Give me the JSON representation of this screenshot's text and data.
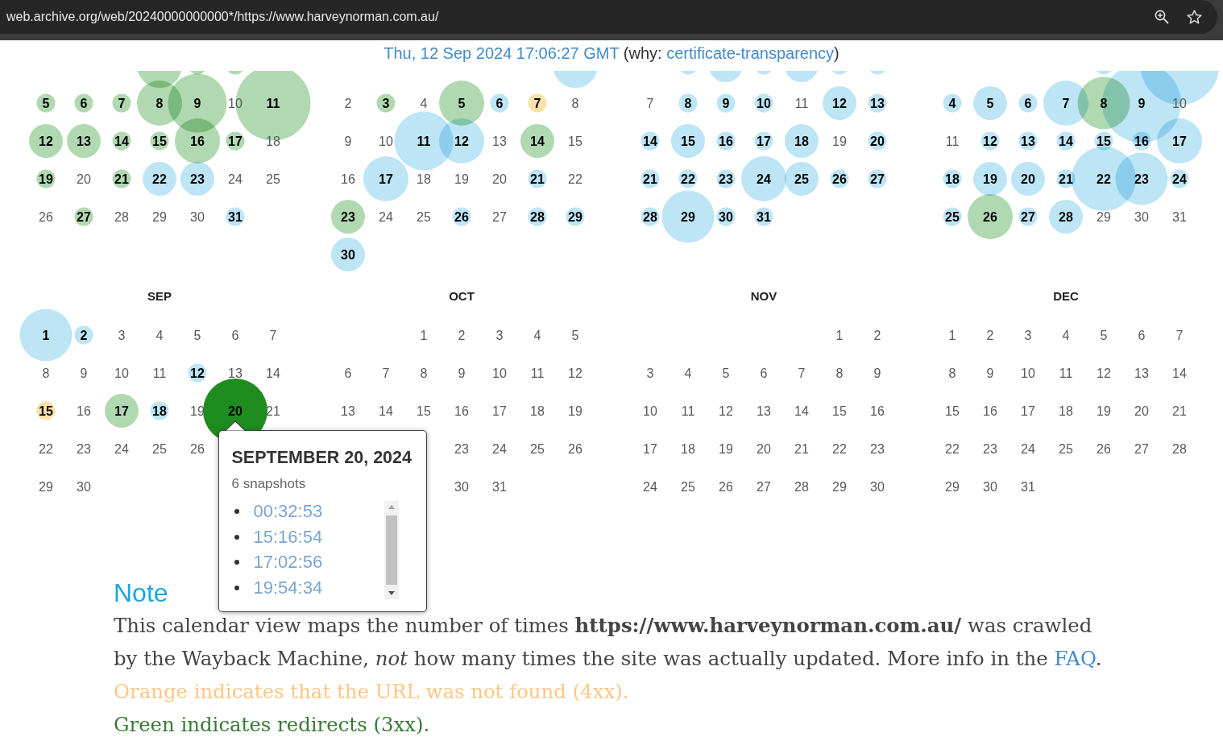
{
  "browser": {
    "url": "web.archive.org/web/20240000000000*/https://www.harveynorman.com.au/"
  },
  "capture": {
    "timestamp": "Thu, 12 Sep 2024 17:06:27 GMT",
    "reason_prefix": "(why:",
    "reason": "certificate-transparency",
    "reason_suffix": ")"
  },
  "calendar": {
    "months": [
      {
        "cut_off_week": [
          {
            "kind": "blank"
          },
          {
            "kind": "blank"
          },
          {
            "kind": "blank"
          },
          {
            "kind": "medium",
            "color": "#b1d9b1"
          },
          {
            "kind": "tiny",
            "color": "#b1d9b1"
          },
          {
            "kind": "tiny",
            "color": "#b1d9b1"
          }
        ],
        "weeks": [
          [
            {
              "kind": "tiny",
              "day": "5",
              "color": "#b1d9b1"
            },
            {
              "kind": "tiny",
              "day": "6",
              "color": "#b1d9b1"
            },
            {
              "kind": "tiny",
              "day": "7",
              "color": "#b1d9b1"
            },
            {
              "kind": "medium",
              "day": "8",
              "color": "#b1d9b1"
            },
            {
              "kind": "xlarge",
              "day": "9",
              "color": "#b1d9b1"
            },
            {
              "kind": "plain",
              "day": "10"
            },
            {
              "kind": "huge",
              "day": "11",
              "color": "#b1d9b1"
            }
          ],
          [
            {
              "kind": "small",
              "day": "12",
              "color": "#b1d9b1"
            },
            {
              "kind": "small",
              "day": "13",
              "color": "#b1d9b1"
            },
            {
              "kind": "tiny",
              "day": "14",
              "color": "#b1d9b1"
            },
            {
              "kind": "tiny",
              "day": "15",
              "color": "#b1d9b1"
            },
            {
              "kind": "medium",
              "day": "16",
              "color": "#b1d9b1"
            },
            {
              "kind": "tiny",
              "day": "17",
              "color": "#b1d9b1"
            },
            {
              "kind": "plain",
              "day": "18"
            }
          ],
          [
            {
              "kind": "tiny",
              "day": "19",
              "color": "#b1d9b1"
            },
            {
              "kind": "plain",
              "day": "20"
            },
            {
              "kind": "tiny",
              "day": "21",
              "color": "#b1d9b1"
            },
            {
              "kind": "small",
              "day": "22",
              "color": "#bde5f6"
            },
            {
              "kind": "small",
              "day": "23",
              "color": "#bde5f6"
            },
            {
              "kind": "plain",
              "day": "24"
            },
            {
              "kind": "plain",
              "day": "25"
            }
          ],
          [
            {
              "kind": "plain",
              "day": "26"
            },
            {
              "kind": "tiny",
              "day": "27",
              "color": "#b1d9b1"
            },
            {
              "kind": "plain",
              "day": "28"
            },
            {
              "kind": "plain",
              "day": "29"
            },
            {
              "kind": "plain",
              "day": "30"
            },
            {
              "kind": "tiny",
              "day": "31",
              "color": "#bde5f6"
            }
          ]
        ]
      },
      {
        "cut_off_week": [
          {
            "kind": "blank"
          },
          {
            "kind": "blank"
          },
          {
            "kind": "blank"
          },
          {
            "kind": "blank"
          },
          {
            "kind": "blank"
          },
          {
            "kind": "blank"
          },
          {
            "kind": "medium",
            "color": "#bde5f6"
          }
        ],
        "weeks": [
          [
            {
              "kind": "plain",
              "day": "2"
            },
            {
              "kind": "tiny",
              "day": "3",
              "color": "#b1d9b1"
            },
            {
              "kind": "plain",
              "day": "4"
            },
            {
              "kind": "medium",
              "day": "5",
              "color": "#b1d9b1"
            },
            {
              "kind": "tiny",
              "day": "6",
              "color": "#bde5f6"
            },
            {
              "kind": "tiny",
              "day": "7",
              "color": "#ffe0a8"
            },
            {
              "kind": "plain",
              "day": "8"
            }
          ],
          [
            {
              "kind": "plain",
              "day": "9"
            },
            {
              "kind": "plain",
              "day": "10"
            },
            {
              "kind": "xlarge",
              "day": "11",
              "color": "#bde5f6"
            },
            {
              "kind": "medium",
              "day": "12",
              "color": "#bde5f6"
            },
            {
              "kind": "plain",
              "day": "13"
            },
            {
              "kind": "small",
              "day": "14",
              "color": "#b1d9b1"
            },
            {
              "kind": "plain",
              "day": "15"
            }
          ],
          [
            {
              "kind": "plain",
              "day": "16"
            },
            {
              "kind": "medium",
              "day": "17",
              "color": "#bde5f6"
            },
            {
              "kind": "plain",
              "day": "18"
            },
            {
              "kind": "plain",
              "day": "19"
            },
            {
              "kind": "plain",
              "day": "20"
            },
            {
              "kind": "tiny",
              "day": "21",
              "color": "#bde5f6"
            },
            {
              "kind": "plain",
              "day": "22"
            }
          ],
          [
            {
              "kind": "small",
              "day": "23",
              "color": "#b1d9b1"
            },
            {
              "kind": "plain",
              "day": "24"
            },
            {
              "kind": "plain",
              "day": "25"
            },
            {
              "kind": "tiny",
              "day": "26",
              "color": "#bde5f6"
            },
            {
              "kind": "plain",
              "day": "27"
            },
            {
              "kind": "tiny",
              "day": "28",
              "color": "#bde5f6"
            },
            {
              "kind": "tiny",
              "day": "29",
              "color": "#bde5f6"
            }
          ],
          [
            {
              "kind": "small",
              "day": "30",
              "color": "#bde5f6"
            }
          ]
        ]
      },
      {
        "cut_off_week": [
          {
            "kind": "blank"
          },
          {
            "kind": "tiny",
            "color": "#bde5f6"
          },
          {
            "kind": "small",
            "color": "#bde5f6"
          },
          {
            "kind": "tiny",
            "color": "#bde5f6"
          },
          {
            "kind": "small",
            "color": "#bde5f6"
          },
          {
            "kind": "tiny",
            "color": "#bde5f6"
          },
          {
            "kind": "tiny",
            "color": "#bde5f6"
          }
        ],
        "weeks": [
          [
            {
              "kind": "plain",
              "day": "7"
            },
            {
              "kind": "tiny",
              "day": "8",
              "color": "#bde5f6"
            },
            {
              "kind": "tiny",
              "day": "9",
              "color": "#bde5f6"
            },
            {
              "kind": "tiny",
              "day": "10",
              "color": "#bde5f6"
            },
            {
              "kind": "plain",
              "day": "11"
            },
            {
              "kind": "small",
              "day": "12",
              "color": "#bde5f6"
            },
            {
              "kind": "tiny",
              "day": "13",
              "color": "#bde5f6"
            }
          ],
          [
            {
              "kind": "tiny",
              "day": "14",
              "color": "#bde5f6"
            },
            {
              "kind": "small",
              "day": "15",
              "color": "#bde5f6"
            },
            {
              "kind": "tiny",
              "day": "16",
              "color": "#bde5f6"
            },
            {
              "kind": "tiny",
              "day": "17",
              "color": "#bde5f6"
            },
            {
              "kind": "small",
              "day": "18",
              "color": "#bde5f6"
            },
            {
              "kind": "plain",
              "day": "19"
            },
            {
              "kind": "tiny",
              "day": "20",
              "color": "#bde5f6"
            }
          ],
          [
            {
              "kind": "tiny",
              "day": "21",
              "color": "#bde5f6"
            },
            {
              "kind": "tiny",
              "day": "22",
              "color": "#bde5f6"
            },
            {
              "kind": "tiny",
              "day": "23",
              "color": "#bde5f6"
            },
            {
              "kind": "medium",
              "day": "24",
              "color": "#bde5f6"
            },
            {
              "kind": "small",
              "day": "25",
              "color": "#bde5f6"
            },
            {
              "kind": "tiny",
              "day": "26",
              "color": "#bde5f6"
            },
            {
              "kind": "tiny",
              "day": "27",
              "color": "#bde5f6"
            }
          ],
          [
            {
              "kind": "tiny",
              "day": "28",
              "color": "#bde5f6"
            },
            {
              "kind": "large",
              "day": "29",
              "color": "#bde5f6"
            },
            {
              "kind": "tiny",
              "day": "30",
              "color": "#bde5f6"
            },
            {
              "kind": "tiny",
              "day": "31",
              "color": "#bde5f6"
            }
          ]
        ]
      },
      {
        "cut_off_week": [
          {
            "kind": "blank"
          },
          {
            "kind": "blank"
          },
          {
            "kind": "blank"
          },
          {
            "kind": "blank"
          },
          {
            "kind": "tiny",
            "color": "#bde5f6"
          },
          {
            "kind": "blank"
          },
          {
            "kind": "giant",
            "color": "#bde5f6"
          }
        ],
        "weeks": [
          [
            {
              "kind": "tiny",
              "day": "4",
              "color": "#bde5f6"
            },
            {
              "kind": "small",
              "day": "5",
              "color": "#bde5f6"
            },
            {
              "kind": "tiny",
              "day": "6",
              "color": "#bde5f6"
            },
            {
              "kind": "medium",
              "day": "7",
              "color": "#bde5f6"
            },
            {
              "kind": "large",
              "day": "8",
              "color": "#b1d9b1"
            },
            {
              "kind": "giant",
              "day": "9",
              "color": "#bde5f6"
            },
            {
              "kind": "plain",
              "day": "10"
            }
          ],
          [
            {
              "kind": "plain",
              "day": "11"
            },
            {
              "kind": "tiny",
              "day": "12",
              "color": "#bde5f6"
            },
            {
              "kind": "tiny",
              "day": "13",
              "color": "#bde5f6"
            },
            {
              "kind": "tiny",
              "day": "14",
              "color": "#bde5f6"
            },
            {
              "kind": "tiny",
              "day": "15",
              "color": "#bde5f6"
            },
            {
              "kind": "tiny",
              "day": "16",
              "color": "#bde5f6"
            },
            {
              "kind": "medium",
              "day": "17",
              "color": "#bde5f6"
            }
          ],
          [
            {
              "kind": "tiny",
              "day": "18",
              "color": "#bde5f6"
            },
            {
              "kind": "small",
              "day": "19",
              "color": "#bde5f6"
            },
            {
              "kind": "small",
              "day": "20",
              "color": "#bde5f6"
            },
            {
              "kind": "tiny",
              "day": "21",
              "color": "#bde5f6"
            },
            {
              "kind": "xxlarge",
              "day": "22",
              "color": "#bde5f6"
            },
            {
              "kind": "large",
              "day": "23",
              "color": "#bde5f6"
            },
            {
              "kind": "tiny",
              "day": "24",
              "color": "#bde5f6"
            }
          ],
          [
            {
              "kind": "tiny",
              "day": "25",
              "color": "#bde5f6"
            },
            {
              "kind": "medium",
              "day": "26",
              "color": "#b1d9b1"
            },
            {
              "kind": "tiny",
              "day": "27",
              "color": "#bde5f6"
            },
            {
              "kind": "small",
              "day": "28",
              "color": "#bde5f6"
            },
            {
              "kind": "plain",
              "day": "29"
            },
            {
              "kind": "plain",
              "day": "30"
            },
            {
              "kind": "plain",
              "day": "31"
            }
          ]
        ]
      },
      {
        "name": "SEP",
        "weeks": [
          [
            {
              "kind": "large",
              "day": "1",
              "color": "#bde5f6"
            },
            {
              "kind": "tiny",
              "day": "2",
              "color": "#bde5f6"
            },
            {
              "kind": "plain",
              "day": "3"
            },
            {
              "kind": "plain",
              "day": "4"
            },
            {
              "kind": "plain",
              "day": "5"
            },
            {
              "kind": "plain",
              "day": "6"
            },
            {
              "kind": "plain",
              "day": "7"
            }
          ],
          [
            {
              "kind": "plain",
              "day": "8"
            },
            {
              "kind": "plain",
              "day": "9"
            },
            {
              "kind": "plain",
              "day": "10"
            },
            {
              "kind": "plain",
              "day": "11"
            },
            {
              "kind": "tiny",
              "day": "12",
              "color": "#bde5f6"
            },
            {
              "kind": "plain",
              "day": "13"
            },
            {
              "kind": "plain",
              "day": "14"
            }
          ],
          [
            {
              "kind": "tiny",
              "day": "15",
              "color": "#ffe0a8"
            },
            {
              "kind": "plain",
              "day": "16"
            },
            {
              "kind": "small",
              "day": "17",
              "color": "#b1d9b1"
            },
            {
              "kind": "tiny",
              "day": "18",
              "color": "#bde5f6"
            },
            {
              "kind": "plain",
              "day": "19"
            },
            {
              "kind": "xxlarge",
              "day": "20",
              "color": "#1e8c1e",
              "popup": {
                "title": "SEPTEMBER 20, 2024",
                "count": "6 snapshots",
                "times": [
                  "00:32:53",
                  "15:16:54",
                  "17:02:56",
                  "19:54:34"
                ]
              }
            },
            {
              "kind": "plain",
              "day": "21"
            }
          ],
          [
            {
              "kind": "plain",
              "day": "22"
            },
            {
              "kind": "plain",
              "day": "23"
            },
            {
              "kind": "plain",
              "day": "24"
            },
            {
              "kind": "plain",
              "day": "25"
            },
            {
              "kind": "plain",
              "day": "26"
            }
          ],
          [
            {
              "kind": "plain",
              "day": "29"
            },
            {
              "kind": "plain",
              "day": "30"
            }
          ]
        ]
      },
      {
        "name": "OCT",
        "weeks": [
          [
            {
              "kind": "blank"
            },
            {
              "kind": "blank"
            },
            {
              "kind": "plain",
              "day": "1"
            },
            {
              "kind": "plain",
              "day": "2"
            },
            {
              "kind": "plain",
              "day": "3"
            },
            {
              "kind": "plain",
              "day": "4"
            },
            {
              "kind": "plain",
              "day": "5"
            }
          ],
          [
            {
              "kind": "plain",
              "day": "6"
            },
            {
              "kind": "plain",
              "day": "7"
            },
            {
              "kind": "plain",
              "day": "8"
            },
            {
              "kind": "plain",
              "day": "9"
            },
            {
              "kind": "plain",
              "day": "10"
            },
            {
              "kind": "plain",
              "day": "11"
            },
            {
              "kind": "plain",
              "day": "12"
            }
          ],
          [
            {
              "kind": "plain",
              "day": "13"
            },
            {
              "kind": "plain",
              "day": "14"
            },
            {
              "kind": "plain",
              "day": "15"
            },
            {
              "kind": "plain",
              "day": "16"
            },
            {
              "kind": "plain",
              "day": "17"
            },
            {
              "kind": "plain",
              "day": "18"
            },
            {
              "kind": "plain",
              "day": "19"
            }
          ],
          [
            {
              "kind": "blank"
            },
            {
              "kind": "blank"
            },
            {
              "kind": "blank"
            },
            {
              "kind": "plain",
              "day": "23"
            },
            {
              "kind": "plain",
              "day": "24"
            },
            {
              "kind": "plain",
              "day": "25"
            },
            {
              "kind": "plain",
              "day": "26"
            }
          ],
          [
            {
              "kind": "blank"
            },
            {
              "kind": "blank"
            },
            {
              "kind": "blank"
            },
            {
              "kind": "plain",
              "day": "30"
            },
            {
              "kind": "plain",
              "day": "31"
            }
          ]
        ]
      },
      {
        "name": "NOV",
        "weeks": [
          [
            {
              "kind": "blank"
            },
            {
              "kind": "blank"
            },
            {
              "kind": "blank"
            },
            {
              "kind": "blank"
            },
            {
              "kind": "blank"
            },
            {
              "kind": "plain",
              "day": "1"
            },
            {
              "kind": "plain",
              "day": "2"
            }
          ],
          [
            {
              "kind": "plain",
              "day": "3"
            },
            {
              "kind": "plain",
              "day": "4"
            },
            {
              "kind": "plain",
              "day": "5"
            },
            {
              "kind": "plain",
              "day": "6"
            },
            {
              "kind": "plain",
              "day": "7"
            },
            {
              "kind": "plain",
              "day": "8"
            },
            {
              "kind": "plain",
              "day": "9"
            }
          ],
          [
            {
              "kind": "plain",
              "day": "10"
            },
            {
              "kind": "plain",
              "day": "11"
            },
            {
              "kind": "plain",
              "day": "12"
            },
            {
              "kind": "plain",
              "day": "13"
            },
            {
              "kind": "plain",
              "day": "14"
            },
            {
              "kind": "plain",
              "day": "15"
            },
            {
              "kind": "plain",
              "day": "16"
            }
          ],
          [
            {
              "kind": "plain",
              "day": "17"
            },
            {
              "kind": "plain",
              "day": "18"
            },
            {
              "kind": "plain",
              "day": "19"
            },
            {
              "kind": "plain",
              "day": "20"
            },
            {
              "kind": "plain",
              "day": "21"
            },
            {
              "kind": "plain",
              "day": "22"
            },
            {
              "kind": "plain",
              "day": "23"
            }
          ],
          [
            {
              "kind": "plain",
              "day": "24"
            },
            {
              "kind": "plain",
              "day": "25"
            },
            {
              "kind": "plain",
              "day": "26"
            },
            {
              "kind": "plain",
              "day": "27"
            },
            {
              "kind": "plain",
              "day": "28"
            },
            {
              "kind": "plain",
              "day": "29"
            },
            {
              "kind": "plain",
              "day": "30"
            }
          ]
        ]
      },
      {
        "name": "DEC",
        "weeks": [
          [
            {
              "kind": "plain",
              "day": "1"
            },
            {
              "kind": "plain",
              "day": "2"
            },
            {
              "kind": "plain",
              "day": "3"
            },
            {
              "kind": "plain",
              "day": "4"
            },
            {
              "kind": "plain",
              "day": "5"
            },
            {
              "kind": "plain",
              "day": "6"
            },
            {
              "kind": "plain",
              "day": "7"
            }
          ],
          [
            {
              "kind": "plain",
              "day": "8"
            },
            {
              "kind": "plain",
              "day": "9"
            },
            {
              "kind": "plain",
              "day": "10"
            },
            {
              "kind": "plain",
              "day": "11"
            },
            {
              "kind": "plain",
              "day": "12"
            },
            {
              "kind": "plain",
              "day": "13"
            },
            {
              "kind": "plain",
              "day": "14"
            }
          ],
          [
            {
              "kind": "plain",
              "day": "15"
            },
            {
              "kind": "plain",
              "day": "16"
            },
            {
              "kind": "plain",
              "day": "17"
            },
            {
              "kind": "plain",
              "day": "18"
            },
            {
              "kind": "plain",
              "day": "19"
            },
            {
              "kind": "plain",
              "day": "20"
            },
            {
              "kind": "plain",
              "day": "21"
            }
          ],
          [
            {
              "kind": "plain",
              "day": "22"
            },
            {
              "kind": "plain",
              "day": "23"
            },
            {
              "kind": "plain",
              "day": "24"
            },
            {
              "kind": "plain",
              "day": "25"
            },
            {
              "kind": "plain",
              "day": "26"
            },
            {
              "kind": "plain",
              "day": "27"
            },
            {
              "kind": "plain",
              "day": "28"
            }
          ],
          [
            {
              "kind": "plain",
              "day": "29"
            },
            {
              "kind": "plain",
              "day": "30"
            },
            {
              "kind": "plain",
              "day": "31"
            }
          ]
        ]
      }
    ]
  },
  "note": {
    "heading": "Note",
    "text": "This calendar view maps the number of times **https://www.harveynorman.com.au/** was crawled by the Wayback Machine, *not* how many times the site was actually updated. More info in the",
    "link": "FAQ",
    "text_end": ".",
    "legend": [
      {
        "text": "Orange indicates that the URL was not found (4xx).",
        "color": "#fbc784"
      },
      {
        "text": "Green indicates redirects (3xx).",
        "color": "#367a36"
      }
    ]
  }
}
